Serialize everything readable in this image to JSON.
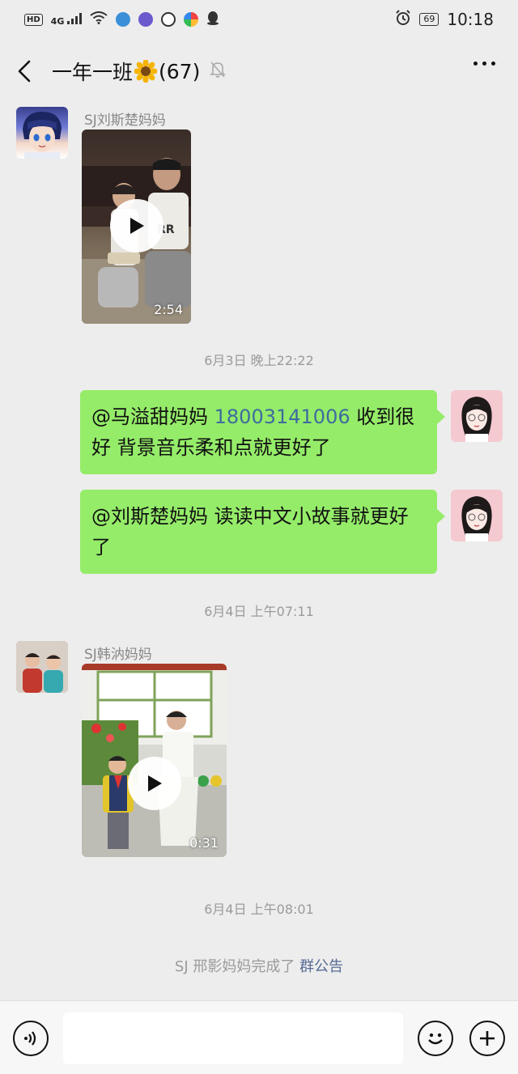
{
  "status_bar": {
    "hd": "HD",
    "signal": "4G",
    "battery": "69",
    "time": "10:18"
  },
  "header": {
    "title": "一年一班",
    "count": "(67)"
  },
  "messages": [
    {
      "sender": "SJ刘斯楚妈妈",
      "duration": "2:54"
    },
    {
      "timestamp": "6月3日 晚上22:22"
    },
    {
      "mention": "@马溢甜妈妈 ",
      "phone": "18003141006",
      "text_after": " 收到很好 背景音乐柔和点就更好了"
    },
    {
      "text": "@刘斯楚妈妈  读读中文小故事就更好了"
    },
    {
      "timestamp": "6月4日 上午07:11"
    },
    {
      "sender": "SJ韩汭妈妈",
      "duration": "0:31"
    },
    {
      "timestamp": "6月4日 上午08:01"
    }
  ],
  "system_notice": {
    "text": "SJ 邢影妈妈完成了 ",
    "link": "群公告"
  },
  "input_bar": {
    "placeholder": ""
  },
  "icons": {
    "back": "back-arrow-icon",
    "mute": "mute-bell-icon",
    "more": "more-icon",
    "voice": "voice-icon",
    "emoji": "emoji-icon",
    "plus": "plus-icon",
    "play": "play-icon"
  },
  "colors": {
    "bubble": "#95ec69",
    "background": "#ededed",
    "link": "#576b95"
  }
}
